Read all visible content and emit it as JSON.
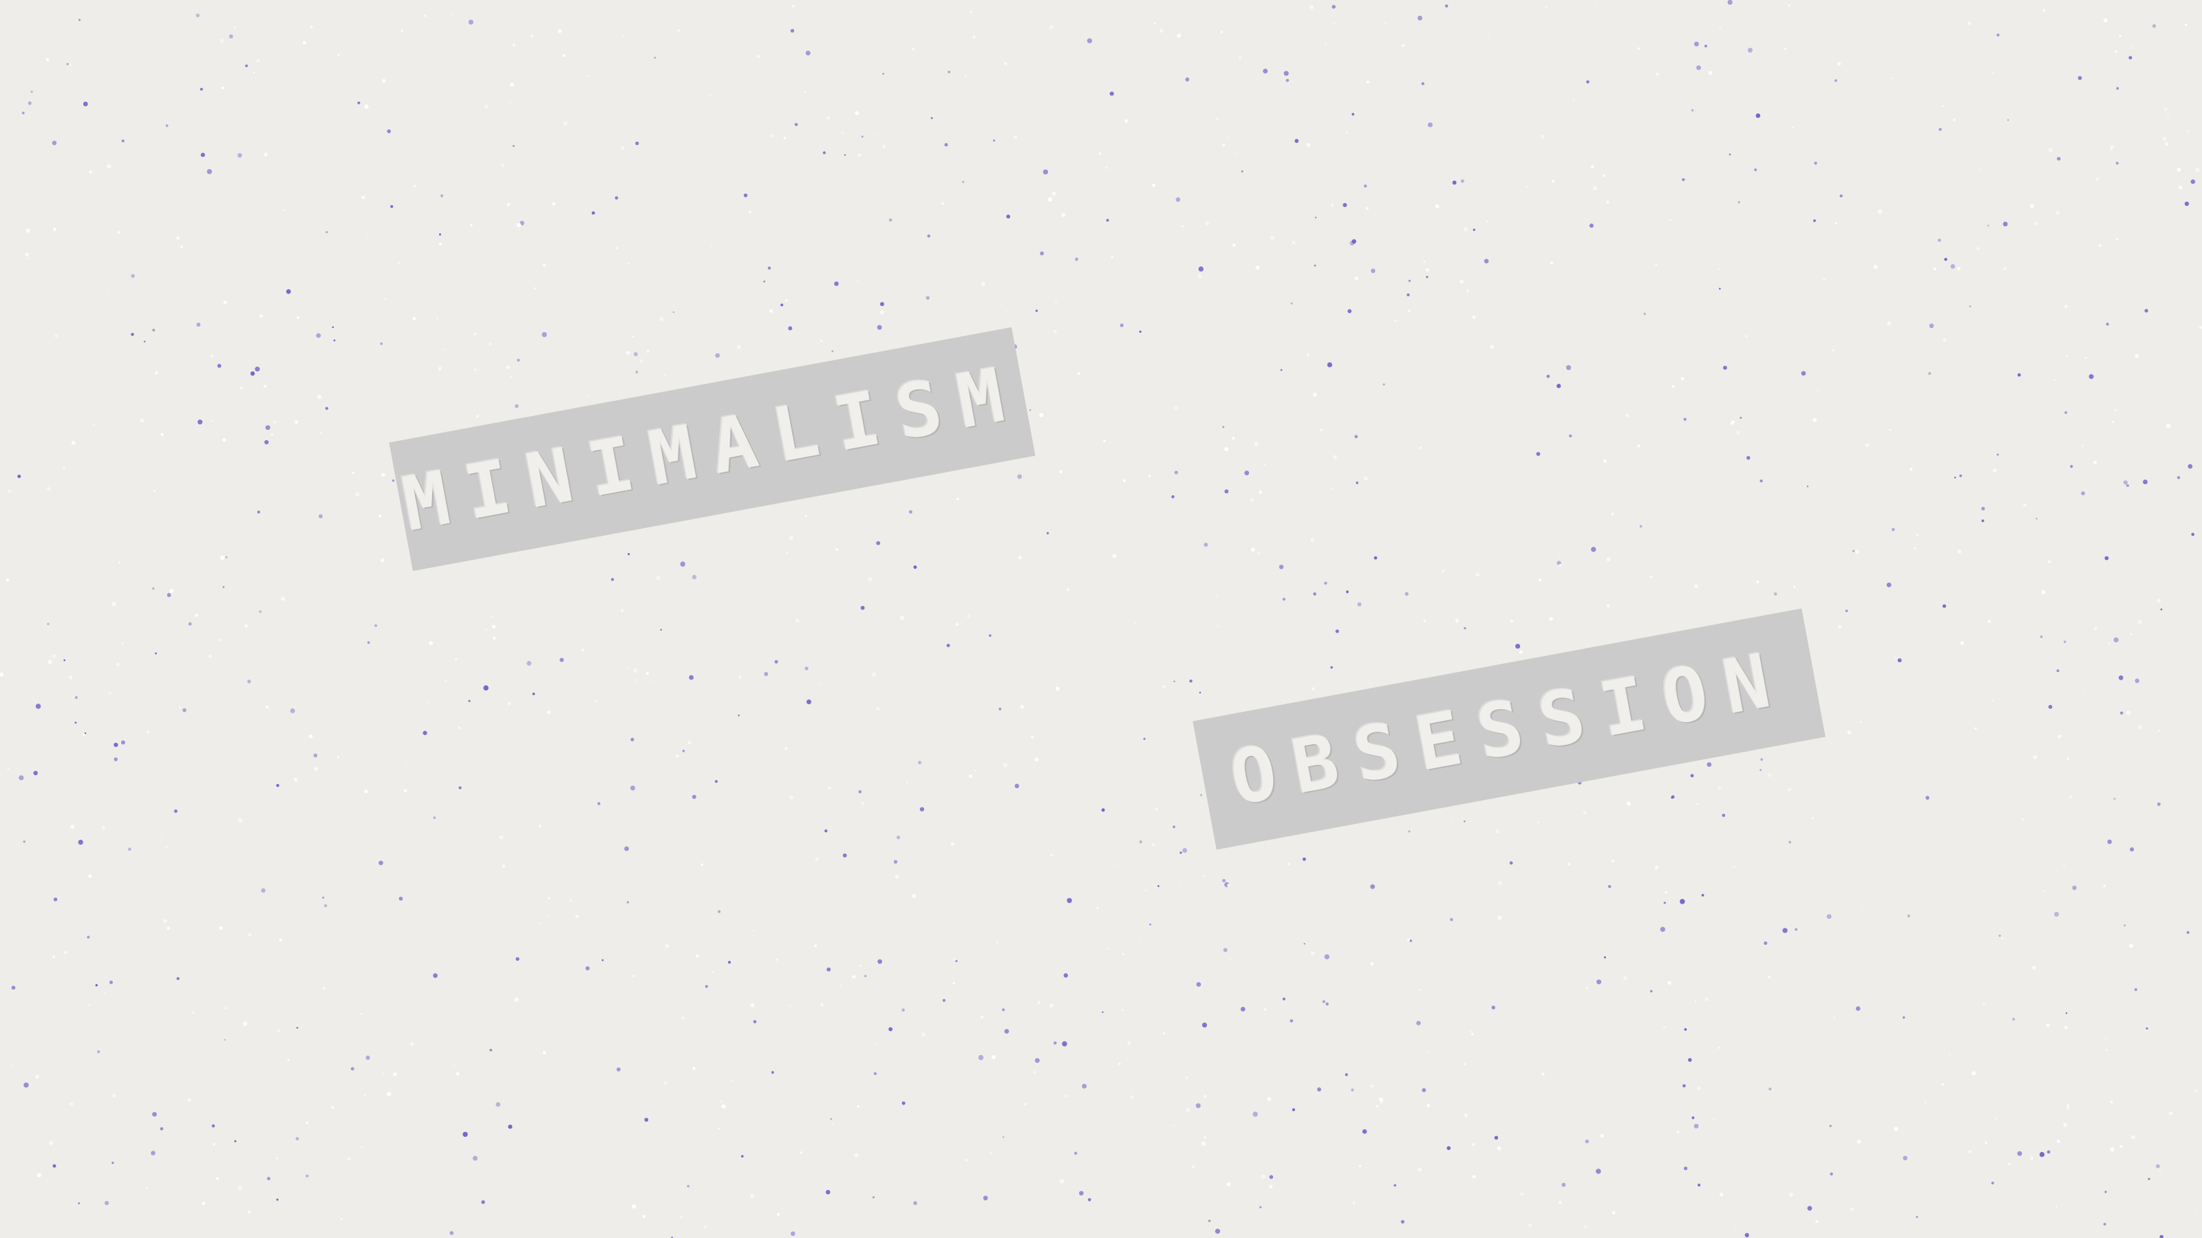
{
  "labels": {
    "first": "MINIMALISM",
    "second": "OBSESSION"
  },
  "colors": {
    "background": "#efede9",
    "tape": "#cbcbcb",
    "lettering": "#f1efeb",
    "speckle_purple": "#6a55c6",
    "speckle_white": "#ffffff"
  }
}
